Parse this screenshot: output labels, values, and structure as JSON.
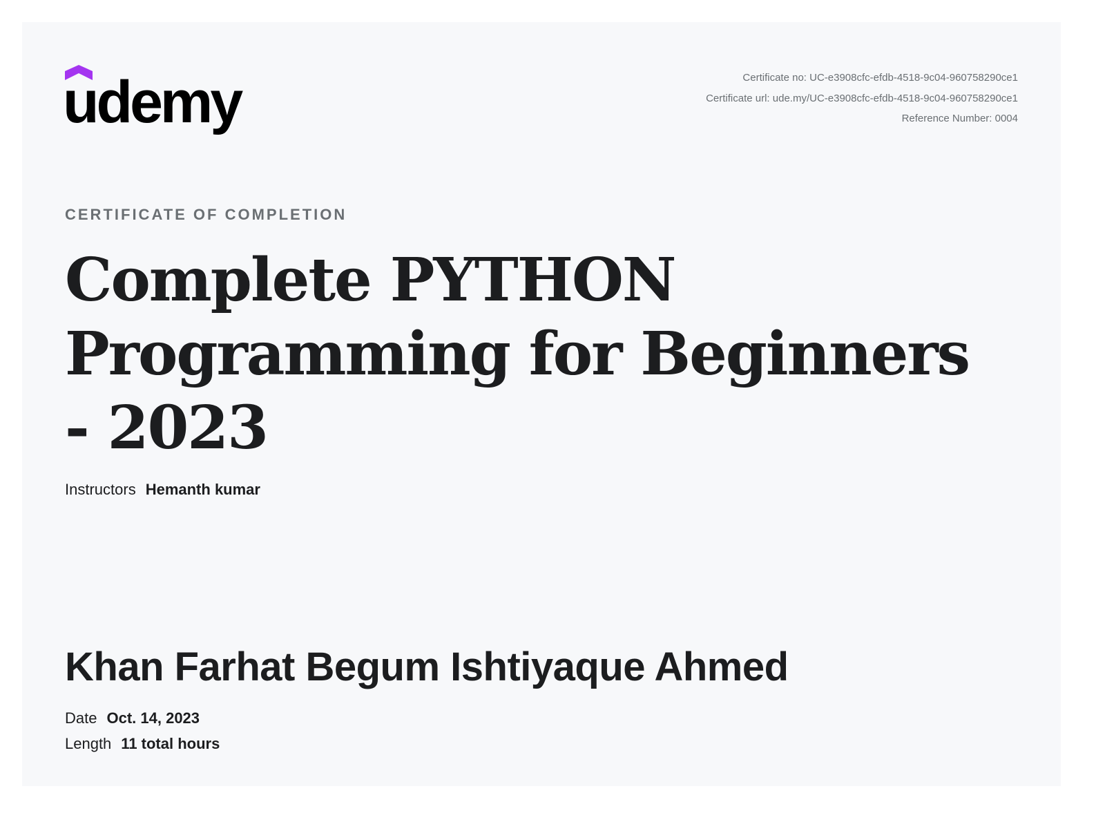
{
  "logo": {
    "text": "udemy",
    "accent_color": "#a435f0"
  },
  "meta": {
    "certificate_no": "Certificate no: UC-e3908cfc-efdb-4518-9c04-960758290ce1",
    "certificate_url": "Certificate url: ude.my/UC-e3908cfc-efdb-4518-9c04-960758290ce1",
    "reference_number": "Reference Number: 0004"
  },
  "eyebrow": "CERTIFICATE OF COMPLETION",
  "course_title": "Complete PYTHON Programming for Beginners - 2023",
  "instructors": {
    "label": "Instructors",
    "value": "Hemanth kumar"
  },
  "recipient": "Khan Farhat Begum Ishtiyaque Ahmed",
  "date": {
    "label": "Date",
    "value": "Oct. 14, 2023"
  },
  "length": {
    "label": "Length",
    "value": "11 total hours"
  }
}
